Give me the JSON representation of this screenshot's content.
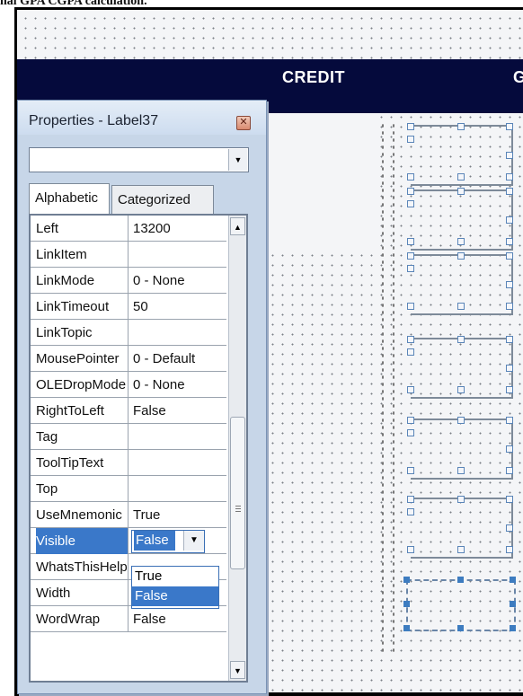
{
  "caption": "nal GPA CGPA calculation.",
  "designer": {
    "columns": [
      "CREDIT",
      "G"
    ]
  },
  "properties": {
    "title": "Properties - Label37",
    "close_icon": "close-icon",
    "object_combo_value": "",
    "tabs": [
      {
        "label": "Alphabetic",
        "active": true
      },
      {
        "label": "Categorized",
        "active": false
      }
    ],
    "rows": [
      {
        "name": "Left",
        "value": "13200"
      },
      {
        "name": "LinkItem",
        "value": ""
      },
      {
        "name": "LinkMode",
        "value": "0 - None"
      },
      {
        "name": "LinkTimeout",
        "value": "50"
      },
      {
        "name": "LinkTopic",
        "value": ""
      },
      {
        "name": "MousePointer",
        "value": "0 - Default"
      },
      {
        "name": "OLEDropMode",
        "value": "0 - None"
      },
      {
        "name": "RightToLeft",
        "value": "False"
      },
      {
        "name": "Tag",
        "value": ""
      },
      {
        "name": "ToolTipText",
        "value": ""
      },
      {
        "name": "Top",
        "value": ""
      },
      {
        "name": "UseMnemonic",
        "value": "True"
      },
      {
        "name": "Visible",
        "value": "False"
      },
      {
        "name": "WhatsThisHelp",
        "value": ""
      },
      {
        "name": "Width",
        "value": ""
      },
      {
        "name": "WordWrap",
        "value": "False"
      }
    ],
    "selected_row": "Visible",
    "dropdown_options": [
      "True",
      "False"
    ],
    "dropdown_highlighted": "False"
  },
  "colors": {
    "header_bar": "#050a3c",
    "selection": "#3a78c9"
  }
}
